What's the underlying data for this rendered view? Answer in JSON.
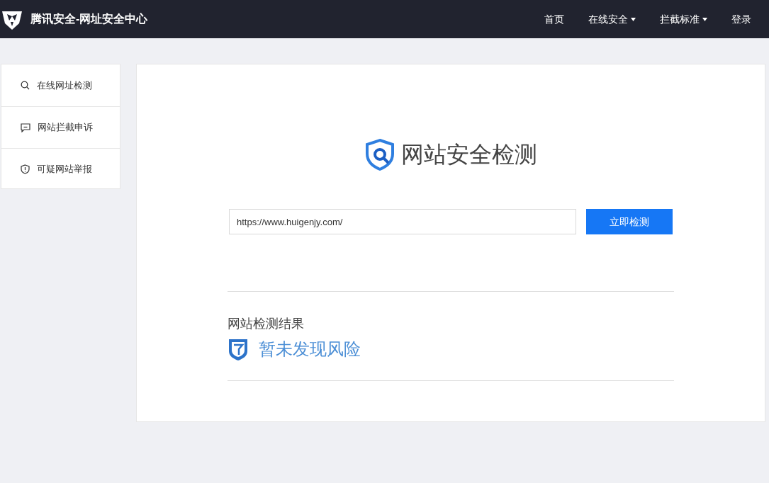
{
  "header": {
    "title": "腾讯安全-网址安全中心",
    "nav": [
      {
        "label": "首页",
        "has_menu": false
      },
      {
        "label": "在线安全",
        "has_menu": true
      },
      {
        "label": "拦截标准",
        "has_menu": true
      },
      {
        "label": "登录",
        "has_menu": false
      }
    ]
  },
  "sidebar": {
    "items": [
      {
        "label": "在线网址检测",
        "kind": "search"
      },
      {
        "label": "网站拦截申诉",
        "kind": "appeal"
      },
      {
        "label": "可疑网站举报",
        "kind": "report"
      }
    ]
  },
  "main": {
    "title": "网站安全检测",
    "url_field": {
      "value": "https://www.huigenjy.com/"
    },
    "check_button": "立即检测",
    "result_label": "网站检测结果",
    "result": "暂未发现风险"
  }
}
